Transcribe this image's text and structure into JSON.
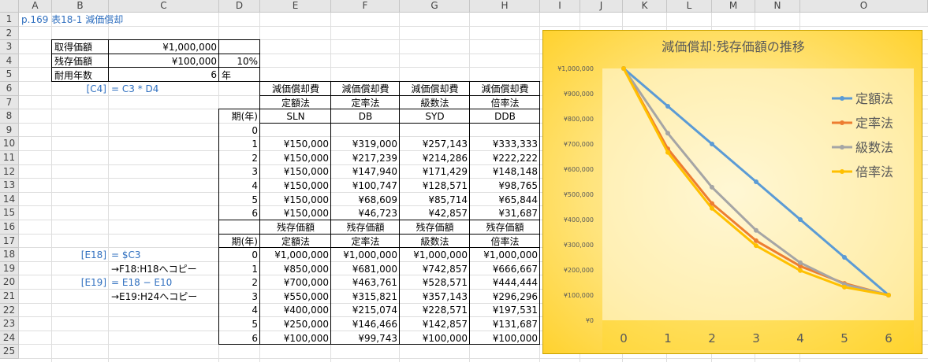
{
  "columns": [
    "A",
    "B",
    "C",
    "D",
    "E",
    "F",
    "G",
    "H",
    "I",
    "J",
    "K",
    "L",
    "M",
    "N",
    "O"
  ],
  "rows": [
    "1",
    "2",
    "3",
    "4",
    "5",
    "6",
    "7",
    "8",
    "9",
    "10",
    "11",
    "12",
    "13",
    "14",
    "15",
    "16",
    "17",
    "18",
    "19",
    "20",
    "21",
    "22",
    "23",
    "24",
    "25"
  ],
  "sheet_title": "p.169 表18-1 減価償却",
  "inputs": {
    "acq_label": "取得価額",
    "acq_value": "¥1,000,000",
    "res_label": "残存価額",
    "res_value": "¥100,000",
    "res_rate": "10%",
    "life_label": "耐用年数",
    "life_value": "6",
    "life_unit": "年"
  },
  "notes": {
    "c4_ref": "[C4]",
    "c4_formula": "= C3 * D4",
    "e18_ref": "[E18]",
    "e18_formula": "= $C3",
    "e18_copy": "→F18:H18へコピー",
    "e19_ref": "[E19]",
    "e19_formula": "= E18 − E10",
    "e19_copy": "→E19:H24へコピー"
  },
  "dep_table": {
    "header_row1": [
      "減価償却費",
      "減価償却費",
      "減価償却費",
      "減価償却費"
    ],
    "header_row2": [
      "定額法",
      "定率法",
      "級数法",
      "倍率法"
    ],
    "period_label": "期(年)",
    "header_row3": [
      "SLN",
      "DB",
      "SYD",
      "DDB"
    ],
    "periods": [
      "0",
      "1",
      "2",
      "3",
      "4",
      "5",
      "6"
    ],
    "values": [
      [
        "",
        "",
        "",
        ""
      ],
      [
        "¥150,000",
        "¥319,000",
        "¥257,143",
        "¥333,333"
      ],
      [
        "¥150,000",
        "¥217,239",
        "¥214,286",
        "¥222,222"
      ],
      [
        "¥150,000",
        "¥147,940",
        "¥171,429",
        "¥148,148"
      ],
      [
        "¥150,000",
        "¥100,747",
        "¥128,571",
        "¥98,765"
      ],
      [
        "¥150,000",
        "¥68,609",
        "¥85,714",
        "¥65,844"
      ],
      [
        "¥150,000",
        "¥46,723",
        "¥42,857",
        "¥31,687"
      ]
    ]
  },
  "res_table": {
    "header_row1": [
      "残存価額",
      "残存価額",
      "残存価額",
      "残存価額"
    ],
    "period_label": "期(年)",
    "header_row2": [
      "定額法",
      "定率法",
      "級数法",
      "倍率法"
    ],
    "periods": [
      "0",
      "1",
      "2",
      "3",
      "4",
      "5",
      "6"
    ],
    "values": [
      [
        "¥1,000,000",
        "¥1,000,000",
        "¥1,000,000",
        "¥1,000,000"
      ],
      [
        "¥850,000",
        "¥681,000",
        "¥742,857",
        "¥666,667"
      ],
      [
        "¥700,000",
        "¥463,761",
        "¥528,571",
        "¥444,444"
      ],
      [
        "¥550,000",
        "¥315,821",
        "¥357,143",
        "¥296,296"
      ],
      [
        "¥400,000",
        "¥215,074",
        "¥228,571",
        "¥197,531"
      ],
      [
        "¥250,000",
        "¥146,466",
        "¥142,857",
        "¥131,687"
      ],
      [
        "¥100,000",
        "¥99,743",
        "¥100,000",
        "¥100,000"
      ]
    ]
  },
  "chart_data": {
    "type": "line",
    "title": "減価償却:残存価額の推移",
    "x": [
      0,
      1,
      2,
      3,
      4,
      5,
      6
    ],
    "ylim": [
      0,
      1000000
    ],
    "y_ticks": [
      "¥0",
      "¥100,000",
      "¥200,000",
      "¥300,000",
      "¥400,000",
      "¥500,000",
      "¥600,000",
      "¥700,000",
      "¥800,000",
      "¥900,000",
      "¥1,000,000"
    ],
    "grid": false,
    "legend": "right",
    "series": [
      {
        "name": "定額法",
        "color": "#5b9bd5",
        "values": [
          1000000,
          850000,
          700000,
          550000,
          400000,
          250000,
          100000
        ]
      },
      {
        "name": "定率法",
        "color": "#ed7d31",
        "values": [
          1000000,
          681000,
          463761,
          315821,
          215074,
          146466,
          99743
        ]
      },
      {
        "name": "級数法",
        "color": "#a5a5a5",
        "values": [
          1000000,
          742857,
          528571,
          357143,
          228571,
          142857,
          100000
        ]
      },
      {
        "name": "倍率法",
        "color": "#ffc000",
        "values": [
          1000000,
          666667,
          444444,
          296296,
          197531,
          131687,
          100000
        ]
      }
    ]
  }
}
